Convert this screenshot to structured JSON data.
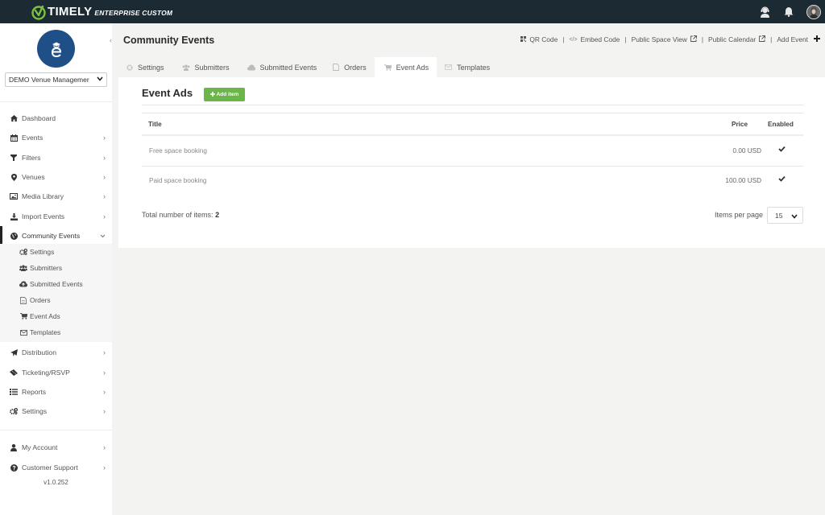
{
  "topbar": {
    "brand": "TIMELY",
    "edition": "ENTERPRISE CUSTOM",
    "icons": [
      "support-agent-icon",
      "bell-icon",
      "user-avatar"
    ]
  },
  "sidebar": {
    "collapse_icon": "chevron-left-icon",
    "venue_select": {
      "value": "DEMO Venue Managemer"
    },
    "items": [
      {
        "label": "Dashboard",
        "icon": "home-icon",
        "has_arrow": false
      },
      {
        "label": "Events",
        "icon": "calendar-icon",
        "has_arrow": true
      },
      {
        "label": "Filters",
        "icon": "filter-icon",
        "has_arrow": true
      },
      {
        "label": "Venues",
        "icon": "map-marker-icon",
        "has_arrow": true
      },
      {
        "label": "Media Library",
        "icon": "image-icon",
        "has_arrow": true
      },
      {
        "label": "Import Events",
        "icon": "download-icon",
        "has_arrow": true
      },
      {
        "label": "Community Events",
        "icon": "globe-icon",
        "has_arrow": true,
        "expanded": true,
        "active": true
      },
      {
        "label": "Distribution",
        "icon": "paper-plane-icon",
        "has_arrow": true
      },
      {
        "label": "Ticketing/RSVP",
        "icon": "ticket-icon",
        "has_arrow": true
      },
      {
        "label": "Reports",
        "icon": "list-icon",
        "has_arrow": true
      },
      {
        "label": "Settings",
        "icon": "cogs-icon",
        "has_arrow": true
      }
    ],
    "sub_items": [
      {
        "label": "Settings",
        "icon": "cogs-icon"
      },
      {
        "label": "Submitters",
        "icon": "users-icon"
      },
      {
        "label": "Submitted Events",
        "icon": "cloud-upload-icon"
      },
      {
        "label": "Orders",
        "icon": "file-icon"
      },
      {
        "label": "Event Ads",
        "icon": "cart-icon"
      },
      {
        "label": "Templates",
        "icon": "envelope-icon"
      }
    ],
    "bottom_items": [
      {
        "label": "My Account",
        "icon": "user-icon",
        "has_arrow": true
      },
      {
        "label": "Customer Support",
        "icon": "question-circle-icon",
        "has_arrow": true
      }
    ],
    "version": "v1.0.252"
  },
  "header": {
    "title": "Community Events",
    "actions": [
      {
        "label": "QR Code",
        "icon": "qr-code-icon"
      },
      {
        "label": "Embed Code",
        "icon": "code-icon"
      },
      {
        "label": "Public Space View",
        "icon": "external-link-icon"
      },
      {
        "label": "Public Calendar",
        "icon": "external-link-icon"
      },
      {
        "label": "Add Event",
        "icon": "plus-icon"
      }
    ],
    "separator": "|"
  },
  "tabs": [
    {
      "label": "Settings",
      "icon": "cog-icon",
      "active": false
    },
    {
      "label": "Submitters",
      "icon": "users-icon",
      "active": false
    },
    {
      "label": "Submitted Events",
      "icon": "cloud-upload-icon",
      "active": false
    },
    {
      "label": "Orders",
      "icon": "file-icon",
      "active": false
    },
    {
      "label": "Event Ads",
      "icon": "cart-icon",
      "active": true
    },
    {
      "label": "Templates",
      "icon": "envelope-icon",
      "active": false
    }
  ],
  "panel": {
    "title": "Event Ads",
    "add_button": "Add item",
    "columns": {
      "title": "Title",
      "price": "Price",
      "enabled": "Enabled"
    },
    "rows": [
      {
        "title": "Free space booking",
        "price": "0.00 USD",
        "enabled": true
      },
      {
        "title": "Paid space booking",
        "price": "100.00 USD",
        "enabled": true
      }
    ],
    "total_label": "Total number of items:",
    "total_value": "2",
    "items_per_page_label": "Items per page",
    "items_per_page_value": "15"
  },
  "colors": {
    "topbar_bg": "#1b2a33",
    "brand_green": "#7ac143",
    "brand_circle": "#1e4f86",
    "add_button": "#6bb54a",
    "page_bg": "#f3f3f2"
  }
}
